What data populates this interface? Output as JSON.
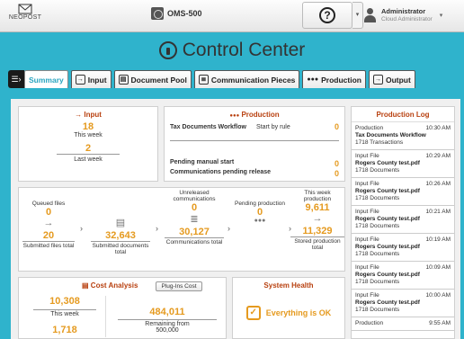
{
  "header": {
    "logo_text": "NEOPOST",
    "server_name": "OMS-500",
    "help_symbol": "?",
    "user_name": "Administrator",
    "user_role": "Cloud Administrator"
  },
  "title": "Control Center",
  "tabs": [
    {
      "label": "Summary",
      "icon": "summary-icon",
      "active": true
    },
    {
      "label": "Input",
      "icon": "input-icon"
    },
    {
      "label": "Document Pool",
      "icon": "document-pool-icon"
    },
    {
      "label": "Communication Pieces",
      "icon": "communication-pieces-icon"
    },
    {
      "label": "Production",
      "icon": "production-icon"
    },
    {
      "label": "Output",
      "icon": "output-icon"
    }
  ],
  "input_panel": {
    "title": "Input",
    "this_week_value": "18",
    "this_week_label": "This week",
    "last_week_value": "2",
    "last_week_label": "Last week"
  },
  "production_panel": {
    "title": "Production",
    "workflow_name": "Tax Documents Workflow",
    "workflow_trigger": "Start by rule",
    "workflow_count": "0",
    "pending_manual_label": "Pending manual start",
    "pending_manual_value": "0",
    "pending_release_label": "Communications pending release",
    "pending_release_value": "0"
  },
  "pipeline": {
    "stages": [
      {
        "top_label": "Queued files",
        "top_value": "0",
        "bottom_value": "20",
        "bottom_label": "Submitted files total"
      },
      {
        "top_label": "",
        "top_value": "",
        "bottom_value": "32,643",
        "bottom_label": "Submitted documents total"
      },
      {
        "top_label": "Unreleased communications",
        "top_value": "0",
        "bottom_value": "30,127",
        "bottom_label": "Communications total"
      },
      {
        "top_label": "Pending production",
        "top_value": "0",
        "bottom_value": "",
        "bottom_label": ""
      },
      {
        "top_label": "This week production",
        "top_value": "9,611",
        "bottom_value": "11,329",
        "bottom_label": "Stored production total"
      }
    ]
  },
  "cost_panel": {
    "title": "Cost Analysis",
    "plugin_button": "Plug-Ins Cost",
    "this_week_value": "10,308",
    "this_week_label": "This week",
    "second_value": "1,718",
    "remaining_value": "484,011",
    "remaining_label": "Remaining from",
    "remaining_total": "500,000"
  },
  "health_panel": {
    "title": "System Health",
    "status": "Everything is OK"
  },
  "log": {
    "title": "Production Log",
    "entries": [
      {
        "type": "Production",
        "time": "10:30 AM",
        "name": "Tax Documents Workflow",
        "detail": "1718 Transactions"
      },
      {
        "type": "Input File",
        "time": "10:29 AM",
        "name": "Rogers County test.pdf",
        "detail": "1718 Documents"
      },
      {
        "type": "Input File",
        "time": "10:26 AM",
        "name": "Rogers County test.pdf",
        "detail": "1718 Documents"
      },
      {
        "type": "Input File",
        "time": "10:21 AM",
        "name": "Rogers County test.pdf",
        "detail": "1718 Documents"
      },
      {
        "type": "Input File",
        "time": "10:19 AM",
        "name": "Rogers County test.pdf",
        "detail": "1718 Documents"
      },
      {
        "type": "Input File",
        "time": "10:09 AM",
        "name": "Rogers County test.pdf",
        "detail": "1718 Documents"
      },
      {
        "type": "Input File",
        "time": "10:00 AM",
        "name": "Rogers County test.pdf",
        "detail": "1718 Documents"
      },
      {
        "type": "Production",
        "time": "9:55 AM",
        "name": "",
        "detail": ""
      }
    ]
  },
  "colors": {
    "background": "#2fb3cc",
    "accent_value": "#e59a1f",
    "panel_title": "#b8400f",
    "active_tab": "#2aa5c0"
  }
}
